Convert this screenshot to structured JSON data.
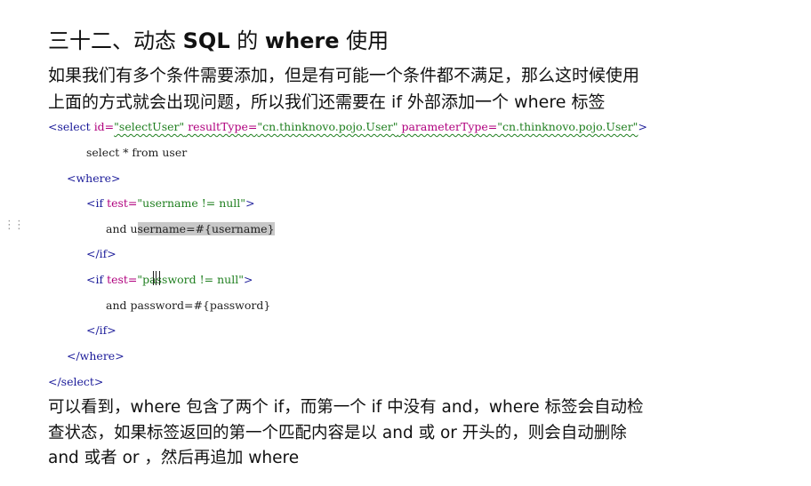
{
  "heading": {
    "prefix": "三十二、动态 ",
    "sql": "SQL",
    "middle": " 的 ",
    "where": "where",
    "suffix": " 使用"
  },
  "intro": {
    "line1": "如果我们有多个条件需要添加，但是有可能一个条件都不满足，那么这时候使用",
    "line2": "上面的方式就会出现问题，所以我们还需要在 if 外部添加一个 where 标签"
  },
  "code": {
    "select_open": {
      "lt": "<select ",
      "id_attr": "id=",
      "id_val": "\"selectUser\"",
      "rt_attr": " resultType=",
      "rt_val": "\"cn.thinknovo.pojo.User\"",
      "pt_attr": " parameterType=",
      "pt_val": "\"cn.thinknovo.pojo.User\"",
      "gt": ">"
    },
    "select_stmt": "select * from user",
    "where_open": "<where>",
    "if1": {
      "lt": "<if ",
      "attr": "test=",
      "val": "\"username != null\"",
      "gt": ">"
    },
    "and1_pre": "and u",
    "and1_hl": "sername=#{username}",
    "if_close1": "</if>",
    "if2": {
      "lt": "<if ",
      "attr": "test=",
      "val": "\"password != null\"",
      "gt": ">"
    },
    "and2": "and password=#{password}",
    "if_close2": "</if>",
    "where_close": "</where>",
    "select_close": "</select>"
  },
  "outro": {
    "line1": "可以看到，where 包含了两个 if，而第一个 if 中没有 and，where 标签会自动检",
    "line2": "查状态，如果标签返回的第一个匹配内容是以  and 或 or  开头的，则会自动删除",
    "line3": "and 或者 or ，然后再追加 where"
  }
}
